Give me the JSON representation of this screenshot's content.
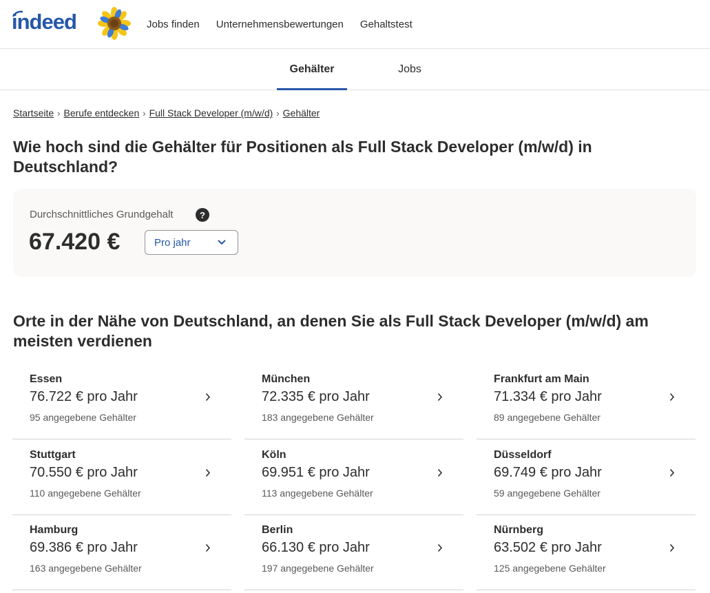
{
  "header": {
    "logo": "indeed",
    "nav": [
      "Jobs finden",
      "Unternehmensbewertungen",
      "Gehaltstest"
    ]
  },
  "tabs": [
    {
      "label": "Gehälter",
      "active": true
    },
    {
      "label": "Jobs",
      "active": false
    }
  ],
  "breadcrumb": [
    "Startseite",
    "Berufe entdecken",
    "Full Stack Developer (m/w/d)",
    "Gehälter"
  ],
  "title": "Wie hoch sind die Gehälter für Positionen als Full Stack Developer (m/w/d) in Deutschland?",
  "salary_card": {
    "label": "Durchschnittliches Grundgehalt",
    "help": "?",
    "value": "67.420 €",
    "period": "Pro jahr"
  },
  "section_title": "Orte in der Nähe von Deutschland, an denen Sie als Full Stack Developer (m/w/d) am meisten verdienen",
  "cities": [
    {
      "name": "Essen",
      "salary": "76.722 € pro Jahr",
      "count": "95 angegebene Gehälter"
    },
    {
      "name": "München",
      "salary": "72.335 € pro Jahr",
      "count": "183 angegebene Gehälter"
    },
    {
      "name": "Frankfurt am Main",
      "salary": "71.334 € pro Jahr",
      "count": "89 angegebene Gehälter"
    },
    {
      "name": "Stuttgart",
      "salary": "70.550 € pro Jahr",
      "count": "110 angegebene Gehälter"
    },
    {
      "name": "Köln",
      "salary": "69.951 € pro Jahr",
      "count": "113 angegebene Gehälter"
    },
    {
      "name": "Düsseldorf",
      "salary": "69.749 € pro Jahr",
      "count": "59 angegebene Gehälter"
    },
    {
      "name": "Hamburg",
      "salary": "69.386 € pro Jahr",
      "count": "163 angegebene Gehälter"
    },
    {
      "name": "Berlin",
      "salary": "66.130 € pro Jahr",
      "count": "197 angegebene Gehälter"
    },
    {
      "name": "Nürnberg",
      "salary": "63.502 € pro Jahr",
      "count": "125 angegebene Gehälter"
    }
  ],
  "colors": {
    "brand": "#2557a7",
    "text": "#2d2d2d",
    "muted": "#595959",
    "card_bg": "#faf9f8"
  }
}
